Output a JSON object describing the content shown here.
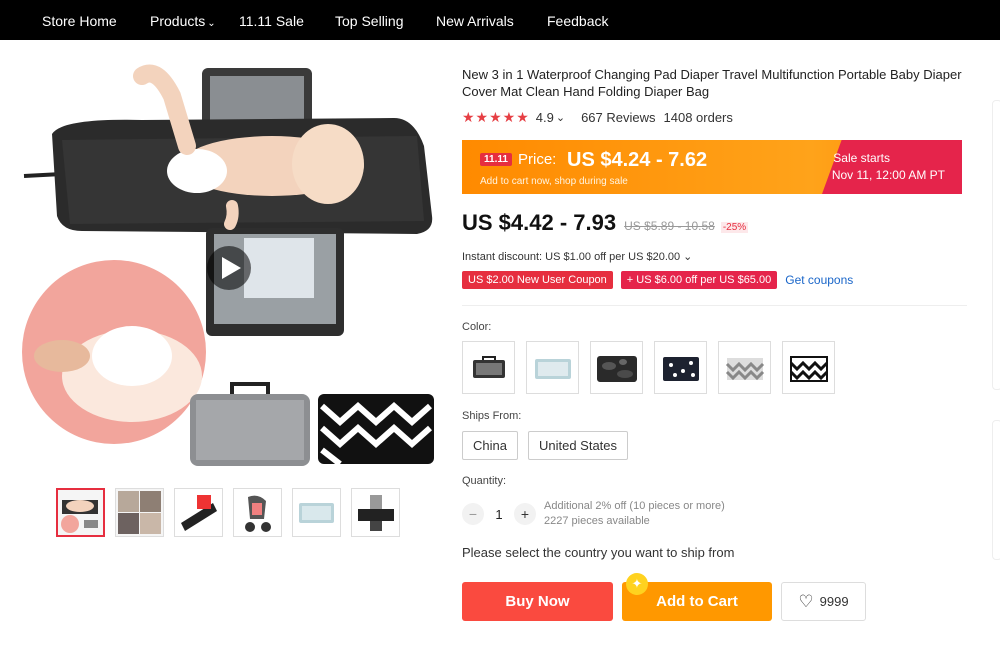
{
  "nav": {
    "store_home": "Store Home",
    "products": "Products",
    "sale": "11.11 Sale",
    "top_selling": "Top Selling",
    "new_arrivals": "New Arrivals",
    "feedback": "Feedback"
  },
  "product": {
    "title": "New 3 in 1 Waterproof Changing Pad Diaper Travel Multifunction Portable Baby Diaper Cover Mat Clean Hand Folding Diaper Bag",
    "rating": "4.9",
    "rating_chevron": "⌄",
    "reviews": "667 Reviews",
    "orders": "1408 orders"
  },
  "banner": {
    "tag": "11.11",
    "price_label": "Price:",
    "price_range": "US $4.24 - 7.62",
    "subtitle": "Add to cart now, shop during sale",
    "sale_line1": "Sale starts",
    "sale_line2": "Nov 11, 12:00 AM PT"
  },
  "pricing": {
    "current": "US $4.42 - 7.93",
    "original": "US $5.89 - 10.58",
    "discount": "-25%",
    "instant_discount": "Instant discount: US $1.00 off per US $20.00 ⌄",
    "coupon1": "US $2.00 New User Coupon",
    "coupon2": "+ US $6.00 off per US $65.00",
    "get_coupons": "Get coupons"
  },
  "options": {
    "color_label": "Color:",
    "ships_label": "Ships From:",
    "ships": [
      "China",
      "United States"
    ],
    "quantity_label": "Quantity:",
    "quantity": "1",
    "qty_info1": "Additional 2% off (10 pieces or more)",
    "qty_info2": "2227 pieces available",
    "please_select": "Please select the country you want to ship from"
  },
  "actions": {
    "buy_now": "Buy Now",
    "add_to_cart": "Add to Cart",
    "wishlist_count": "9999"
  },
  "icons": {
    "play": "play-icon",
    "heart": "heart-icon",
    "star": "star-icon"
  },
  "colors": {
    "accent_red": "#e62e3f",
    "banner_orange": "#ff9800",
    "buy_red": "#fa4a3f"
  }
}
